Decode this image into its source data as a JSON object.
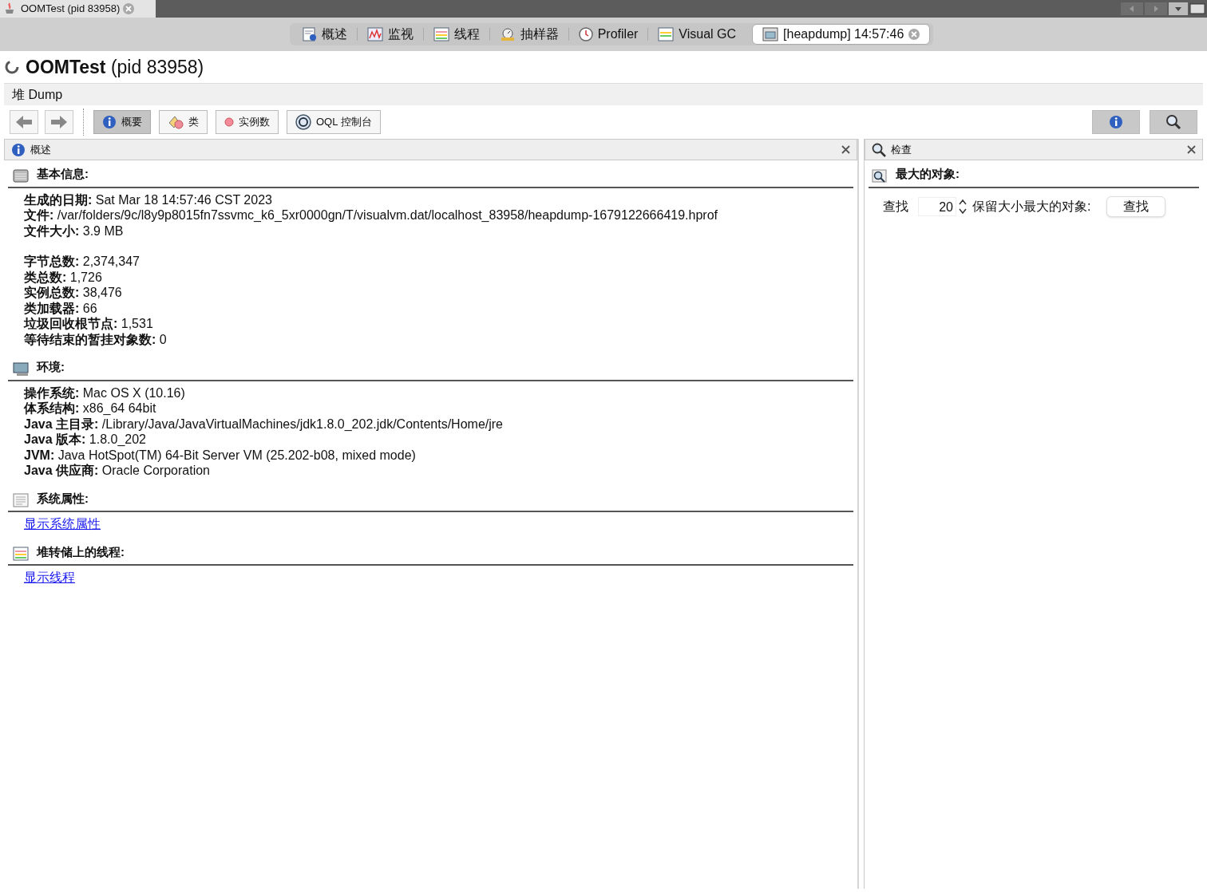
{
  "window_tab": {
    "title": "OOMTest (pid 83958)"
  },
  "view_tabs": [
    {
      "label": "概述",
      "selected": false
    },
    {
      "label": "监视",
      "selected": false
    },
    {
      "label": "线程",
      "selected": false
    },
    {
      "label": "抽样器",
      "selected": false
    },
    {
      "label": "Profiler",
      "selected": false
    },
    {
      "label": "Visual GC",
      "selected": false
    },
    {
      "label": "[heapdump] 14:57:46",
      "selected": true
    }
  ],
  "heading": "**OOMTest** (pid 83958)",
  "subheading": "堆 Dump",
  "toolbar": [
    {
      "label": "概要",
      "selected": true
    },
    {
      "label": "类",
      "selected": false
    },
    {
      "label": "实例数",
      "selected": false
    },
    {
      "label": "OQL 控制台",
      "selected": false
    }
  ],
  "left_panel": {
    "title": "概述",
    "sections": [
      {
        "title": "基本信息:",
        "kind": "fields",
        "groups": [
          [
            "**生成的日期:** Sat Mar 18 14:57:46 CST 2023",
            "**文件:** /var/folders/9c/l8y9p8015fn7ssvmc_k6_5xr0000gn/T/visualvm.dat/localhost_83958/heapdump-1679122666419.hprof",
            "**文件大小:** 3.9 MB"
          ],
          [
            "**字节总数:** 2,374,347",
            "**类总数:** 1,726",
            "**实例总数:** 38,476",
            "**类加载器:** 66",
            "**垃圾回收根节点:** 1,531",
            "**等待结束的暂挂对象数:** 0"
          ]
        ]
      },
      {
        "title": "环境:",
        "kind": "fields",
        "groups": [
          [
            "**操作系统:** Mac OS X (10.16)",
            "**体系结构:** x86_64 64bit",
            "**Java 主目录:** /Library/Java/JavaVirtualMachines/jdk1.8.0_202.jdk/Contents/Home/jre",
            "**Java 版本:** 1.8.0_202",
            "**JVM:** Java HotSpot(TM) 64-Bit Server VM (25.202-b08, mixed mode)",
            "**Java 供应商:** Oracle Corporation"
          ]
        ]
      },
      {
        "title": "系统属性:",
        "kind": "link",
        "link": "显示系统属性"
      },
      {
        "title": "堆转储上的线程:",
        "kind": "link",
        "link": "显示线程"
      }
    ]
  },
  "right_panel": {
    "title": "检查",
    "section_title": "最大的对象:",
    "find_label": "查找",
    "count": "20",
    "count_label": "保留大小最大的对象:",
    "button": "查找"
  }
}
